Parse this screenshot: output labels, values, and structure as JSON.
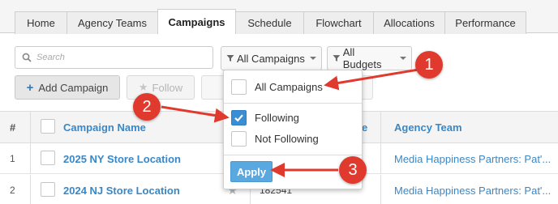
{
  "tabs": [
    {
      "label": "Home",
      "active": false
    },
    {
      "label": "Agency Teams",
      "active": false
    },
    {
      "label": "Campaigns",
      "active": true
    },
    {
      "label": "Schedule",
      "active": false
    },
    {
      "label": "Flowchart",
      "active": false
    },
    {
      "label": "Allocations",
      "active": false
    },
    {
      "label": "Performance",
      "active": false
    }
  ],
  "toolbar": {
    "search_placeholder": "Search",
    "campaign_filter_label": "All Campaigns",
    "budget_filter_label": "All Budgets",
    "add_campaign_label": "Add Campaign",
    "follow_label": "Follow"
  },
  "table": {
    "headers": {
      "num": "#",
      "name": "Campaign Name",
      "partial": "e",
      "team": "Agency Team"
    },
    "rows": [
      {
        "num": "1",
        "name": "2025 NY Store Location",
        "team": "Media Happiness Partners: Pat'..."
      },
      {
        "num": "2",
        "name": "2024 NJ Store Location",
        "partial": "182541",
        "team": "Media Happiness Partners: Pat'..."
      }
    ]
  },
  "dropdown": {
    "items": [
      {
        "label": "All Campaigns",
        "checked": false
      },
      {
        "label": "Following",
        "checked": true
      },
      {
        "label": "Not Following",
        "checked": false
      }
    ],
    "apply_label": "Apply"
  },
  "callouts": [
    "1",
    "2",
    "3"
  ],
  "colors": {
    "link": "#3a87c6",
    "accent": "#3a8ed4",
    "callout": "#e03a2e"
  },
  "icons": {
    "search": "search-icon",
    "filter": "filter-icon",
    "plus": "plus-icon",
    "star": "star-icon",
    "check": "check-icon"
  }
}
